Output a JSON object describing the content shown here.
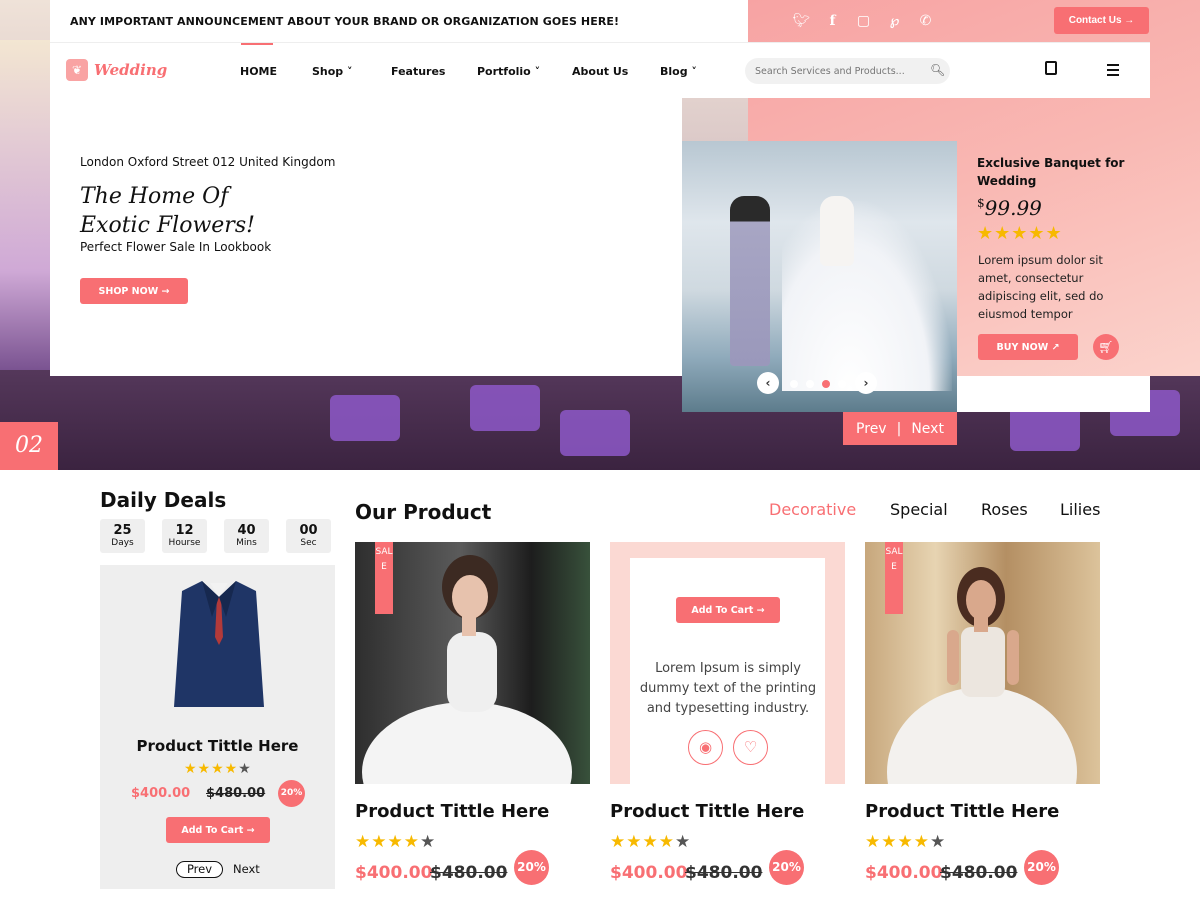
{
  "announcement": "ANY IMPORTANT ANNOUNCEMENT ABOUT YOUR BRAND OR ORGANIZATION GOES HERE!",
  "social_icons": [
    "twitter-icon",
    "facebook-icon",
    "instagram-icon",
    "pinterest-icon",
    "whatsapp-icon"
  ],
  "contact_label": "Contact Us →",
  "brand": {
    "name": "Wedding",
    "accent": "#f86f73"
  },
  "nav": {
    "items": [
      "HOME",
      "Shop ˅",
      "Features",
      "Portfolio ˅",
      "About Us",
      "Blog ˅"
    ],
    "active": "HOME",
    "search_placeholder": "Search Services and Products..."
  },
  "hero": {
    "address": "London Oxford Street 012  United Kingdom",
    "title_line1": "The Home Of",
    "title_line2": "Exotic Flowers!",
    "subtitle": "Perfect Flower Sale In Lookbook",
    "shop_now": "SHOP NOW →",
    "badge": "02",
    "slide_active_dot": 3,
    "slide_count": 4
  },
  "featured": {
    "title": "Exclusive Banquet for Wedding",
    "currency": "$",
    "price": "99.99",
    "rating": 5,
    "description": "Lorem ipsum dolor sit amet, consectetur adipiscing elit, sed do eiusmod tempor",
    "buy_now": "BUY NOW ↗",
    "prev": "Prev",
    "next": "Next"
  },
  "daily_deals": {
    "title": "Daily Deals",
    "countdown": [
      {
        "value": "25",
        "label": "Days"
      },
      {
        "value": "12",
        "label": "Hourse"
      },
      {
        "value": "40",
        "label": "Mins"
      },
      {
        "value": "00",
        "label": "Sec"
      }
    ],
    "product": {
      "title": "Product Tittle Here",
      "rating": 4,
      "price": "$400.00",
      "old_price": "$480.00",
      "discount": "20%",
      "add_to_cart": "Add To Cart →",
      "prev": "Prev",
      "next": "Next"
    }
  },
  "our_product": {
    "title": "Our Product",
    "filters": [
      "Decorative",
      "Special",
      "Roses",
      "Lilies"
    ],
    "active_filter": "Decorative",
    "sale_label": "SALE",
    "hover_add_to_cart": "Add To Cart →",
    "hover_text": "Lorem Ipsum is simply dummy text of the printing and typesetting industry.",
    "products": [
      {
        "title": "Product Tittle Here",
        "rating": 4,
        "price": "$400.00",
        "old_price": "$480.00",
        "discount": "20%"
      },
      {
        "title": "Product Tittle Here",
        "rating": 4,
        "price": "$400.00",
        "old_price": "$480.00",
        "discount": "20%"
      },
      {
        "title": "Product Tittle Here",
        "rating": 4,
        "price": "$400.00",
        "old_price": "$480.00",
        "discount": "20%"
      }
    ]
  }
}
